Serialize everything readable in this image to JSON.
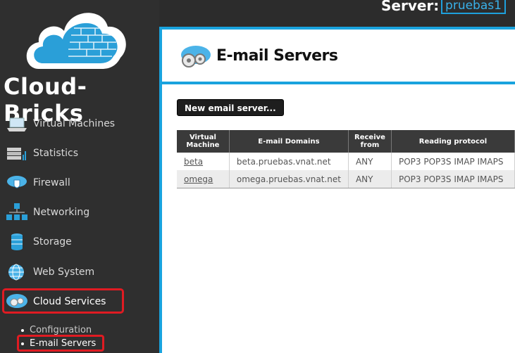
{
  "brand": {
    "name": "Cloud-Bricks"
  },
  "header": {
    "server_label": "Server:",
    "server_value": "pruebas1"
  },
  "sidebar": {
    "items": [
      {
        "label": "Virtual Machines",
        "icon": "laptop-icon"
      },
      {
        "label": "Statistics",
        "icon": "server-stats-icon"
      },
      {
        "label": "Firewall",
        "icon": "shield-cloud-icon"
      },
      {
        "label": "Networking",
        "icon": "network-icon"
      },
      {
        "label": "Storage",
        "icon": "database-icon"
      },
      {
        "label": "Web System",
        "icon": "globe-icon"
      },
      {
        "label": "Cloud Services",
        "icon": "cloud-gears-icon"
      }
    ],
    "subitems": [
      {
        "label": "Configuration"
      },
      {
        "label": "E-mail Servers"
      }
    ]
  },
  "page": {
    "title": "E-mail Servers",
    "new_button": "New email server...",
    "table": {
      "headers": [
        "Virtual Machine",
        "E-mail Domains",
        "Receive from",
        "Reading protocol"
      ],
      "rows": [
        {
          "vm": "beta",
          "domains": "beta.pruebas.vnat.net",
          "receive": "ANY",
          "protocol": "POP3  POP3S  IMAP  IMAPS"
        },
        {
          "vm": "omega",
          "domains": "omega.pruebas.vnat.net",
          "receive": "ANY",
          "protocol": "POP3  POP3S  IMAP  IMAPS"
        }
      ]
    }
  },
  "colors": {
    "accent": "#19a3de",
    "highlight": "#e01b22",
    "sidebar_bg": "#2f2f2f"
  }
}
